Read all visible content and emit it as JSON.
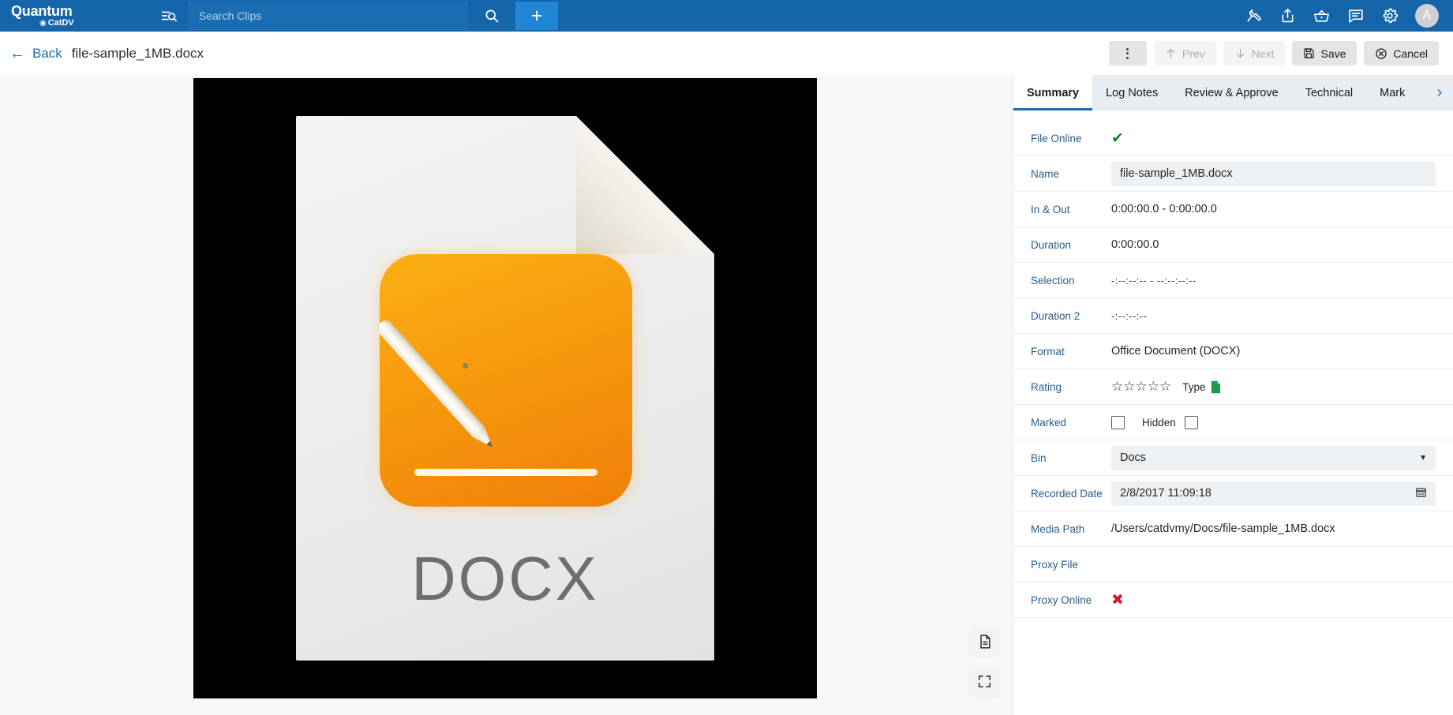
{
  "topbar": {
    "logo_main": "Quantum",
    "logo_swirl_icon": "swirl-icon",
    "logo_sub": "CatDV",
    "filter_icon": "filter-search-icon",
    "search_placeholder": "Search Clips",
    "search_value": "",
    "search_icon": "search-icon",
    "add_label": "+",
    "icons": [
      {
        "name": "wrench-icon"
      },
      {
        "name": "share-upload-icon"
      },
      {
        "name": "basket-icon"
      },
      {
        "name": "comment-icon"
      },
      {
        "name": "gear-icon"
      }
    ],
    "avatar_initial": "A"
  },
  "subbar": {
    "back_label": "Back",
    "doc_title": "file-sample_1MB.docx",
    "kebab_label": "",
    "prev_label": "Prev",
    "next_label": "Next",
    "save_label": "Save",
    "cancel_label": "Cancel"
  },
  "preview": {
    "thumbnail_text": "DOCX",
    "tool_document_icon": "document-icon",
    "tool_fullscreen_icon": "fullscreen-icon"
  },
  "panel": {
    "tabs": [
      {
        "label": "Summary",
        "active": true
      },
      {
        "label": "Log Notes",
        "active": false
      },
      {
        "label": "Review & Approve",
        "active": false
      },
      {
        "label": "Technical",
        "active": false
      },
      {
        "label": "Mark",
        "active": false
      }
    ],
    "tab_next_icon": "chevron-right-icon",
    "fields": {
      "file_online_label": "File Online",
      "file_online_value": "✔",
      "name_label": "Name",
      "name_value": "file-sample_1MB.docx",
      "in_out_label": "In & Out",
      "in_out_value": "0:00:00.0 - 0:00:00.0",
      "duration_label": "Duration",
      "duration_value": "0:00:00.0",
      "selection_label": "Selection",
      "selection_value": "-:--:--:-- - --:--:--:--",
      "duration2_label": "Duration 2",
      "duration2_value": "-:--:--:--",
      "format_label": "Format",
      "format_value": "Office Document (DOCX)",
      "rating_label": "Rating",
      "rating_value": 0,
      "rating_stars": "☆☆☆☆☆",
      "type_label": "Type",
      "type_icon": "green-document-icon",
      "marked_label": "Marked",
      "marked_checked": false,
      "hidden_label": "Hidden",
      "hidden_checked": false,
      "bin_label": "Bin",
      "bin_value": "Docs",
      "recorded_date_label": "Recorded Date",
      "recorded_date_value": "2/8/2017 11:09:18",
      "calendar_icon": "calendar-icon",
      "media_path_label": "Media Path",
      "media_path_value": "/Users/catdvmy/Docs/file-sample_1MB.docx",
      "proxy_file_label": "Proxy File",
      "proxy_file_value": "",
      "proxy_online_label": "Proxy Online",
      "proxy_online_value": "✖"
    }
  },
  "colors": {
    "brand_blue": "#1565ab",
    "accent_blue": "#1a6cb3",
    "tab_strip": "#e8edf1",
    "field_bg": "#eef1f4",
    "label_blue": "#2a5c87",
    "ok_green": "#14862f",
    "error_red": "#c7242b",
    "docx_orange": "#f79a0d"
  }
}
